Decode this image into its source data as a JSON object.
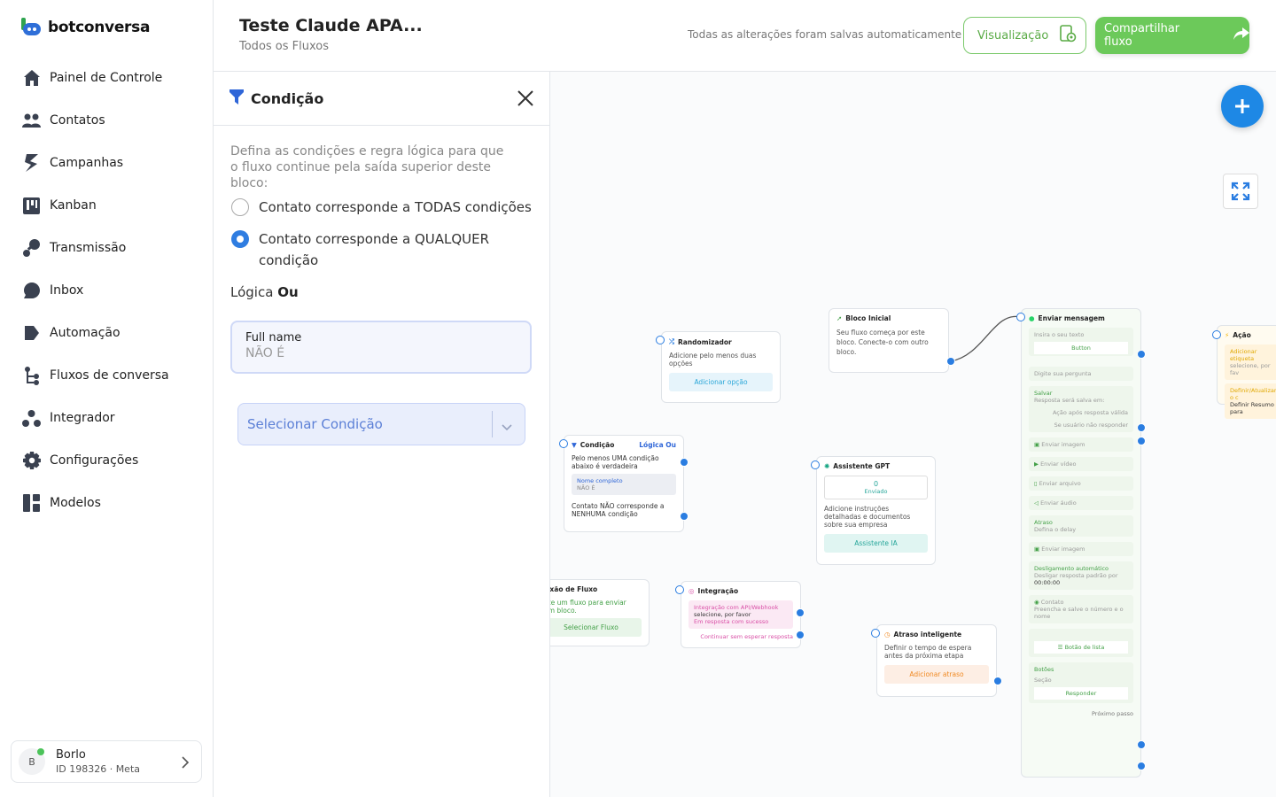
{
  "app": {
    "name": "botconversa"
  },
  "sidebar": {
    "items": [
      {
        "label": "Painel de Controle",
        "icon": "home-icon"
      },
      {
        "label": "Contatos",
        "icon": "users-icon"
      },
      {
        "label": "Campanhas",
        "icon": "campaign-icon"
      },
      {
        "label": "Kanban",
        "icon": "kanban-icon"
      },
      {
        "label": "Transmissão",
        "icon": "broadcast-icon"
      },
      {
        "label": "Inbox",
        "icon": "chat-icon"
      },
      {
        "label": "Automação",
        "icon": "automation-icon"
      },
      {
        "label": "Fluxos de conversa",
        "icon": "flow-icon"
      },
      {
        "label": "Integrador",
        "icon": "integrator-icon"
      },
      {
        "label": "Configurações",
        "icon": "gear-icon"
      },
      {
        "label": "Modelos",
        "icon": "templates-icon"
      }
    ],
    "user": {
      "initial": "B",
      "name": "Borlo",
      "id_line": "ID 198326 · Meta"
    }
  },
  "header": {
    "title": "Teste Claude APA...",
    "subtitle": "Todos os Fluxos",
    "saved": "Todas as alterações foram salvas automaticamente",
    "preview": "Visualização",
    "share": "Compartilhar fluxo"
  },
  "panel": {
    "title": "Condição",
    "description": "Defina as condições e regra lógica para que o fluxo continue pela saída superior deste bloco:",
    "option_all": "Contato corresponde a TODAS condições",
    "option_any": "Contato corresponde a QUALQUER condição",
    "logic_label": "Lógica",
    "logic_value": "Ou",
    "condition": {
      "field": "Full name",
      "operator": "NÃO É"
    },
    "select_placeholder": "Selecionar Condição"
  },
  "canvas": {
    "randomizer": {
      "title": "Randomizador",
      "desc": "Adicione pelo menos duas opções",
      "btn": "Adicionar opção"
    },
    "start": {
      "title": "Bloco Inicial",
      "desc": "Seu fluxo começa por este bloco. Conecte-o com outro bloco."
    },
    "condition": {
      "title": "Condição",
      "logic": "Lógica Ou",
      "line1": "Pelo menos UMA condição abaixo é verdadeira",
      "chip_field": "Nome completo",
      "chip_op": "NÃO É",
      "line2": "Contato NÃO corresponde a NENHUMA condição"
    },
    "gpt": {
      "title": "Assistente GPT",
      "count": "0",
      "count_label": "Enviado",
      "desc": "Adicione instruções detalhadas e documentos sobre sua empresa",
      "btn": "Assistente IA"
    },
    "connect": {
      "title": "nexão de Fluxo",
      "desc": "ecte um fluxo para enviar com bloco.",
      "btn": "Selecionar Fluxo"
    },
    "integration": {
      "title": "Integração",
      "l1": "Integração com API/Webhook",
      "l2": "selecione, por favor",
      "l3": "Em resposta com sucesso",
      "l4": "Continuar sem esperar resposta"
    },
    "delay": {
      "title": "Atraso inteligente",
      "desc": "Definir o tempo de espera antes da próxima etapa",
      "btn": "Adicionar atraso"
    },
    "send": {
      "title": "Enviar mensagem",
      "text_ph": "Insira o seu texto",
      "button": "Button",
      "question": "Digite sua pergunta",
      "save_label": "Salvar",
      "save_desc": "Resposta será salva em:",
      "valid": "Ação após resposta válida",
      "noreply": "Se usuário não responder",
      "img": "Enviar imagem",
      "video": "Enviar vídeo",
      "file": "Enviar arquivo",
      "audio": "Enviar áudio",
      "delay_label": "Atraso",
      "delay_desc": "Defina o delay",
      "img2": "Enviar imagem",
      "auto_off": "Desligamento automático",
      "auto_off_desc": "Desligar resposta padrão por",
      "auto_off_time": "00:00:00",
      "contact": "Contato",
      "contact_desc": "Preencha e salve o número e o nome",
      "list_btn": "Botão de lista",
      "buttons_label": "Botões",
      "section": "Seção",
      "reply": "Responder",
      "next": "Próximo passo"
    },
    "action": {
      "title": "Ação",
      "l1": "Adicionar etiqueta",
      "l2": "selecione, por fav",
      "l3": "Definir/Atualizar o c",
      "l4": "Definir Resumo para"
    }
  },
  "colors": {
    "brand_green": "#6cc95a",
    "accent_blue": "#2a7de1"
  }
}
